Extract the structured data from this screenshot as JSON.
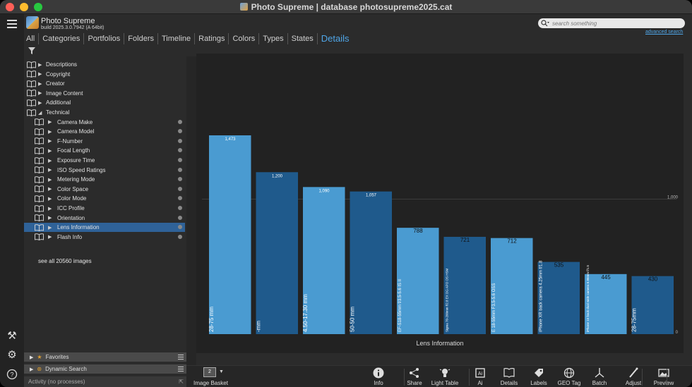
{
  "window": {
    "title": "Photo Supreme | database photosupreme2025.cat"
  },
  "app": {
    "name": "Photo Supreme",
    "build": "build 2025.3.0.7942 (A 64bit)"
  },
  "tabs": [
    {
      "label": "All"
    },
    {
      "label": "Categories"
    },
    {
      "label": "Portfolios"
    },
    {
      "label": "Folders"
    },
    {
      "label": "Timeline"
    },
    {
      "label": "Ratings"
    },
    {
      "label": "Colors"
    },
    {
      "label": "Types"
    },
    {
      "label": "States"
    },
    {
      "label": "Details"
    }
  ],
  "active_tab": "Details",
  "search": {
    "placeholder": "search something",
    "advanced_label": "advanced search"
  },
  "tree": [
    {
      "label": "Descriptions",
      "level": 0,
      "expanded": false
    },
    {
      "label": "Copyright",
      "level": 0,
      "expanded": false
    },
    {
      "label": "Creator",
      "level": 0,
      "expanded": false
    },
    {
      "label": "Image Content",
      "level": 0,
      "expanded": false
    },
    {
      "label": "Additional",
      "level": 0,
      "expanded": false
    },
    {
      "label": "Technical",
      "level": 0,
      "expanded": true
    },
    {
      "label": "Camera Make",
      "level": 1,
      "expanded": false
    },
    {
      "label": "Camera Model",
      "level": 1,
      "expanded": false
    },
    {
      "label": "F-Number",
      "level": 1,
      "expanded": false
    },
    {
      "label": "Focal Length",
      "level": 1,
      "expanded": false
    },
    {
      "label": "Exposure Time",
      "level": 1,
      "expanded": false
    },
    {
      "label": "ISO Speed Ratings",
      "level": 1,
      "expanded": false
    },
    {
      "label": "Metering Mode",
      "level": 1,
      "expanded": false
    },
    {
      "label": "Color Space",
      "level": 1,
      "expanded": false
    },
    {
      "label": "Color Mode",
      "level": 1,
      "expanded": false
    },
    {
      "label": "ICC Profile",
      "level": 1,
      "expanded": false
    },
    {
      "label": "Orientation",
      "level": 1,
      "expanded": false
    },
    {
      "label": "Lens Information",
      "level": 1,
      "expanded": false,
      "selected": true
    },
    {
      "label": "Flash Info",
      "level": 1,
      "expanded": false
    }
  ],
  "see_all": "see all 20560 images",
  "panels": {
    "favorites": "Favorites",
    "dynamic_search": "Dynamic Search",
    "activity": "Activity (no processes)"
  },
  "basket": {
    "count": "2",
    "label": "Image Basket"
  },
  "toolbar": [
    {
      "label": "Info",
      "icon": "info-icon"
    },
    {
      "label": "Share",
      "icon": "share-icon"
    },
    {
      "label": "Light Table",
      "icon": "light-table-icon"
    },
    {
      "label": "Ai",
      "icon": "ai-icon"
    },
    {
      "label": "Details",
      "icon": "details-icon"
    },
    {
      "label": "Labels",
      "icon": "labels-icon"
    },
    {
      "label": "GEO Tag",
      "icon": "geo-tag-icon"
    },
    {
      "label": "Batch",
      "icon": "batch-icon"
    },
    {
      "label": "Adjust",
      "icon": "adjust-icon"
    },
    {
      "label": "Preview",
      "icon": "preview-icon"
    }
  ],
  "colors": {
    "accent": "#4fa6e8",
    "selection": "#2f6298",
    "bar_light": "#4a9bd1",
    "bar_dark": "#1f5a8c"
  },
  "chart_data": {
    "type": "bar",
    "xlabel": "Lens Information",
    "ylabel": "",
    "categories": [
      "28-75 mm",
      "-mm",
      "4.50-17.30 mm",
      "50-50 mm",
      "EF-S18-55mm f/3.5-5.6 IS II",
      "Sigma 70-200mm f/2.8 EX DG APO OS HSM",
      "E 18-55mm F3.5-5.6 OSS",
      "iPhone XR back camera 4.25mm f/1.8",
      "iPhone 15 back dual wide camera 6.86mm f/1.5",
      "28-75mm"
    ],
    "values": [
      1473,
      1200,
      1090,
      1057,
      788,
      721,
      712,
      535,
      445,
      430
    ],
    "value_labels": [
      "1,473",
      "1,200",
      "1,090",
      "1,057",
      "788",
      "721",
      "712",
      "535",
      "445",
      "430"
    ],
    "reference_line": 1000,
    "reference_label": "1,000",
    "zero_label": "0",
    "ylim": [
      0,
      1580
    ]
  }
}
